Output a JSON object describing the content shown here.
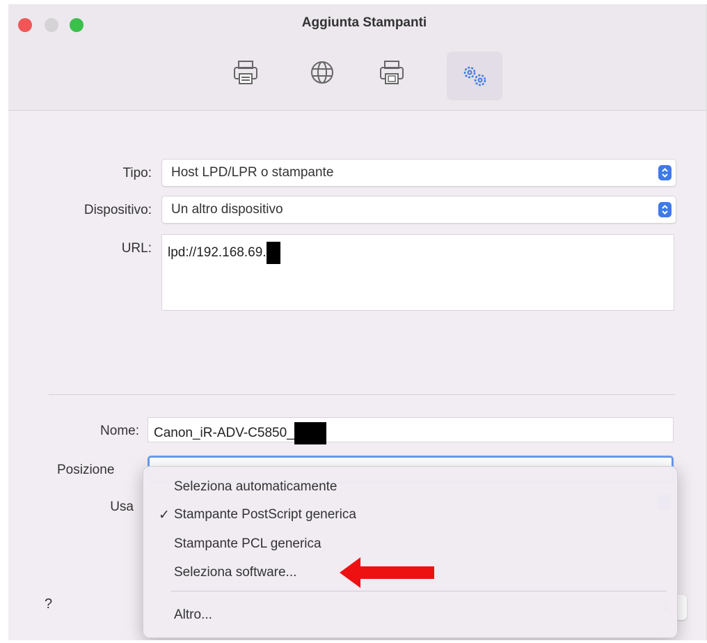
{
  "window": {
    "title": "Aggiunta Stampanti"
  },
  "toolbar": {
    "items": [
      {
        "icon": "default-printer-icon"
      },
      {
        "icon": "ip-globe-icon"
      },
      {
        "icon": "windows-printer-icon"
      },
      {
        "icon": "advanced-gears-icon",
        "selected": true
      }
    ]
  },
  "form": {
    "tipo_label": "Tipo:",
    "tipo_value": "Host LPD/LPR o stampante",
    "dispositivo_label": "Dispositivo:",
    "dispositivo_value": "Un altro dispositivo",
    "url_label": "URL:",
    "url_value": "lpd://192.168.69.",
    "nome_label": "Nome:",
    "nome_value": "Canon_iR-ADV-C5850_",
    "posizione_label": "Posizione",
    "usa_label": "Usa"
  },
  "driver_menu": {
    "items": [
      {
        "label": "Seleziona automaticamente",
        "checked": false
      },
      {
        "label": "Stampante PostScript generica",
        "checked": true
      },
      {
        "label": "Stampante PCL generica",
        "checked": false
      },
      {
        "label": "Seleziona software...",
        "checked": false
      },
      {
        "label": "Altro...",
        "checked": false
      }
    ],
    "check_glyph": "✓"
  },
  "footer": {
    "help_label": "?",
    "add_label": "i"
  },
  "colors": {
    "accent": "#3f7ae8",
    "annotation_arrow": "#ee1111"
  }
}
